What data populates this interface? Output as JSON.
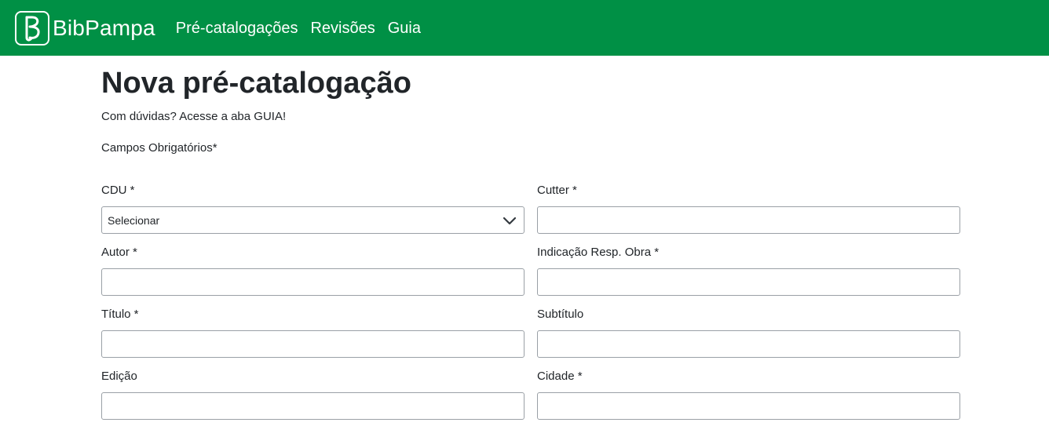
{
  "navbar": {
    "brand_letter": "B",
    "brand_name": "BibPampa",
    "links": [
      "Pré-catalogações",
      "Revisões",
      "Guia"
    ],
    "bg_color": "#009045"
  },
  "main": {
    "title": "Nova pré-catalogação",
    "hint": "Com dúvidas? Acesse a aba GUIA!",
    "required_note": "Campos Obrigatórios*"
  },
  "form": {
    "cdu": {
      "label": "CDU *",
      "value": "Selecionar"
    },
    "cutter": {
      "label": "Cutter *",
      "value": ""
    },
    "autor": {
      "label": "Autor *",
      "value": ""
    },
    "indicacao": {
      "label": "Indicação Resp. Obra *",
      "value": ""
    },
    "titulo": {
      "label": "Título *",
      "value": ""
    },
    "subtitulo": {
      "label": "Subtítulo",
      "value": ""
    },
    "edicao": {
      "label": "Edição",
      "value": ""
    },
    "cidade": {
      "label": "Cidade *",
      "value": ""
    }
  },
  "icons": {
    "logo": "b-logo-icon",
    "select_arrow": "chevron-down-icon"
  }
}
